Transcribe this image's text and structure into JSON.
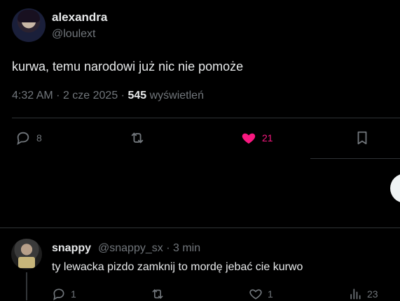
{
  "tweet": {
    "author_name": "alexandra",
    "author_handle": "@loulext",
    "text": "kurwa, temu narodowi już nic nie pomoże",
    "time": "4:32 AM",
    "sep1": "·",
    "date": "2 cze 2025",
    "sep2": "·",
    "views_count": "545",
    "views_label": "wyświetleń",
    "actions": {
      "reply_count": "8",
      "repost_count": "",
      "like_count": "21"
    },
    "colors": {
      "like": "#f91880",
      "muted": "#71767b",
      "text": "#e7e9ea"
    }
  },
  "reply": {
    "author_name": "snappy",
    "author_handle": "@snappy_sx",
    "sep": "·",
    "time": "3 min",
    "text": "ty lewacka pizdo zamknij to mordę jebać cie kurwo",
    "actions": {
      "reply_count": "1",
      "repost_count": "",
      "like_count": "1",
      "views_count": "23"
    }
  },
  "icons": {
    "reply": "speech-bubble-icon",
    "repost": "repost-arrows-icon",
    "like": "heart-icon",
    "bookmark": "bookmark-icon",
    "views": "bar-chart-icon"
  }
}
